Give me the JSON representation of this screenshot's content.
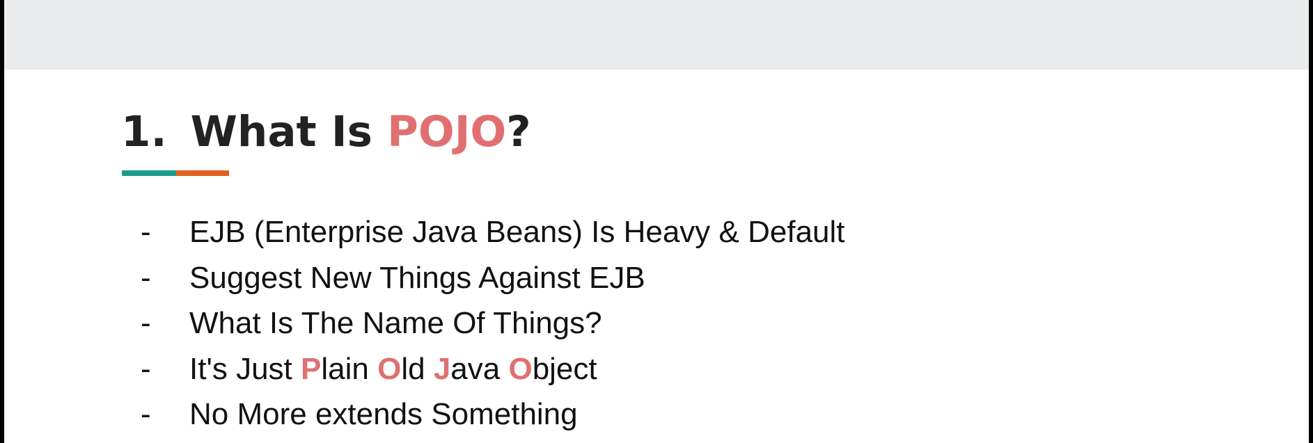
{
  "colors": {
    "accent_text": "#e07070",
    "underline_left": "#1a9a8a",
    "underline_right": "#e0601e",
    "header_band": "#e9ebec"
  },
  "slide": {
    "title": {
      "number": "1.",
      "prefix": "What Is",
      "highlight": "POJO",
      "suffix": "?"
    },
    "bullet_marker": "-",
    "bullets": [
      {
        "text": "EJB (Enterprise Java Beans) Is Heavy & Default"
      },
      {
        "text": "Suggest New Things Against EJB"
      },
      {
        "text": "What Is The Name Of Things?"
      },
      {
        "parts": [
          {
            "t": "It's Just ",
            "hl": false
          },
          {
            "t": "P",
            "hl": true
          },
          {
            "t": "lain ",
            "hl": false
          },
          {
            "t": "O",
            "hl": true
          },
          {
            "t": "ld ",
            "hl": false
          },
          {
            "t": "J",
            "hl": true
          },
          {
            "t": "ava ",
            "hl": false
          },
          {
            "t": "O",
            "hl": true
          },
          {
            "t": "bject",
            "hl": false
          }
        ]
      },
      {
        "text": "No More extends Something"
      }
    ]
  }
}
